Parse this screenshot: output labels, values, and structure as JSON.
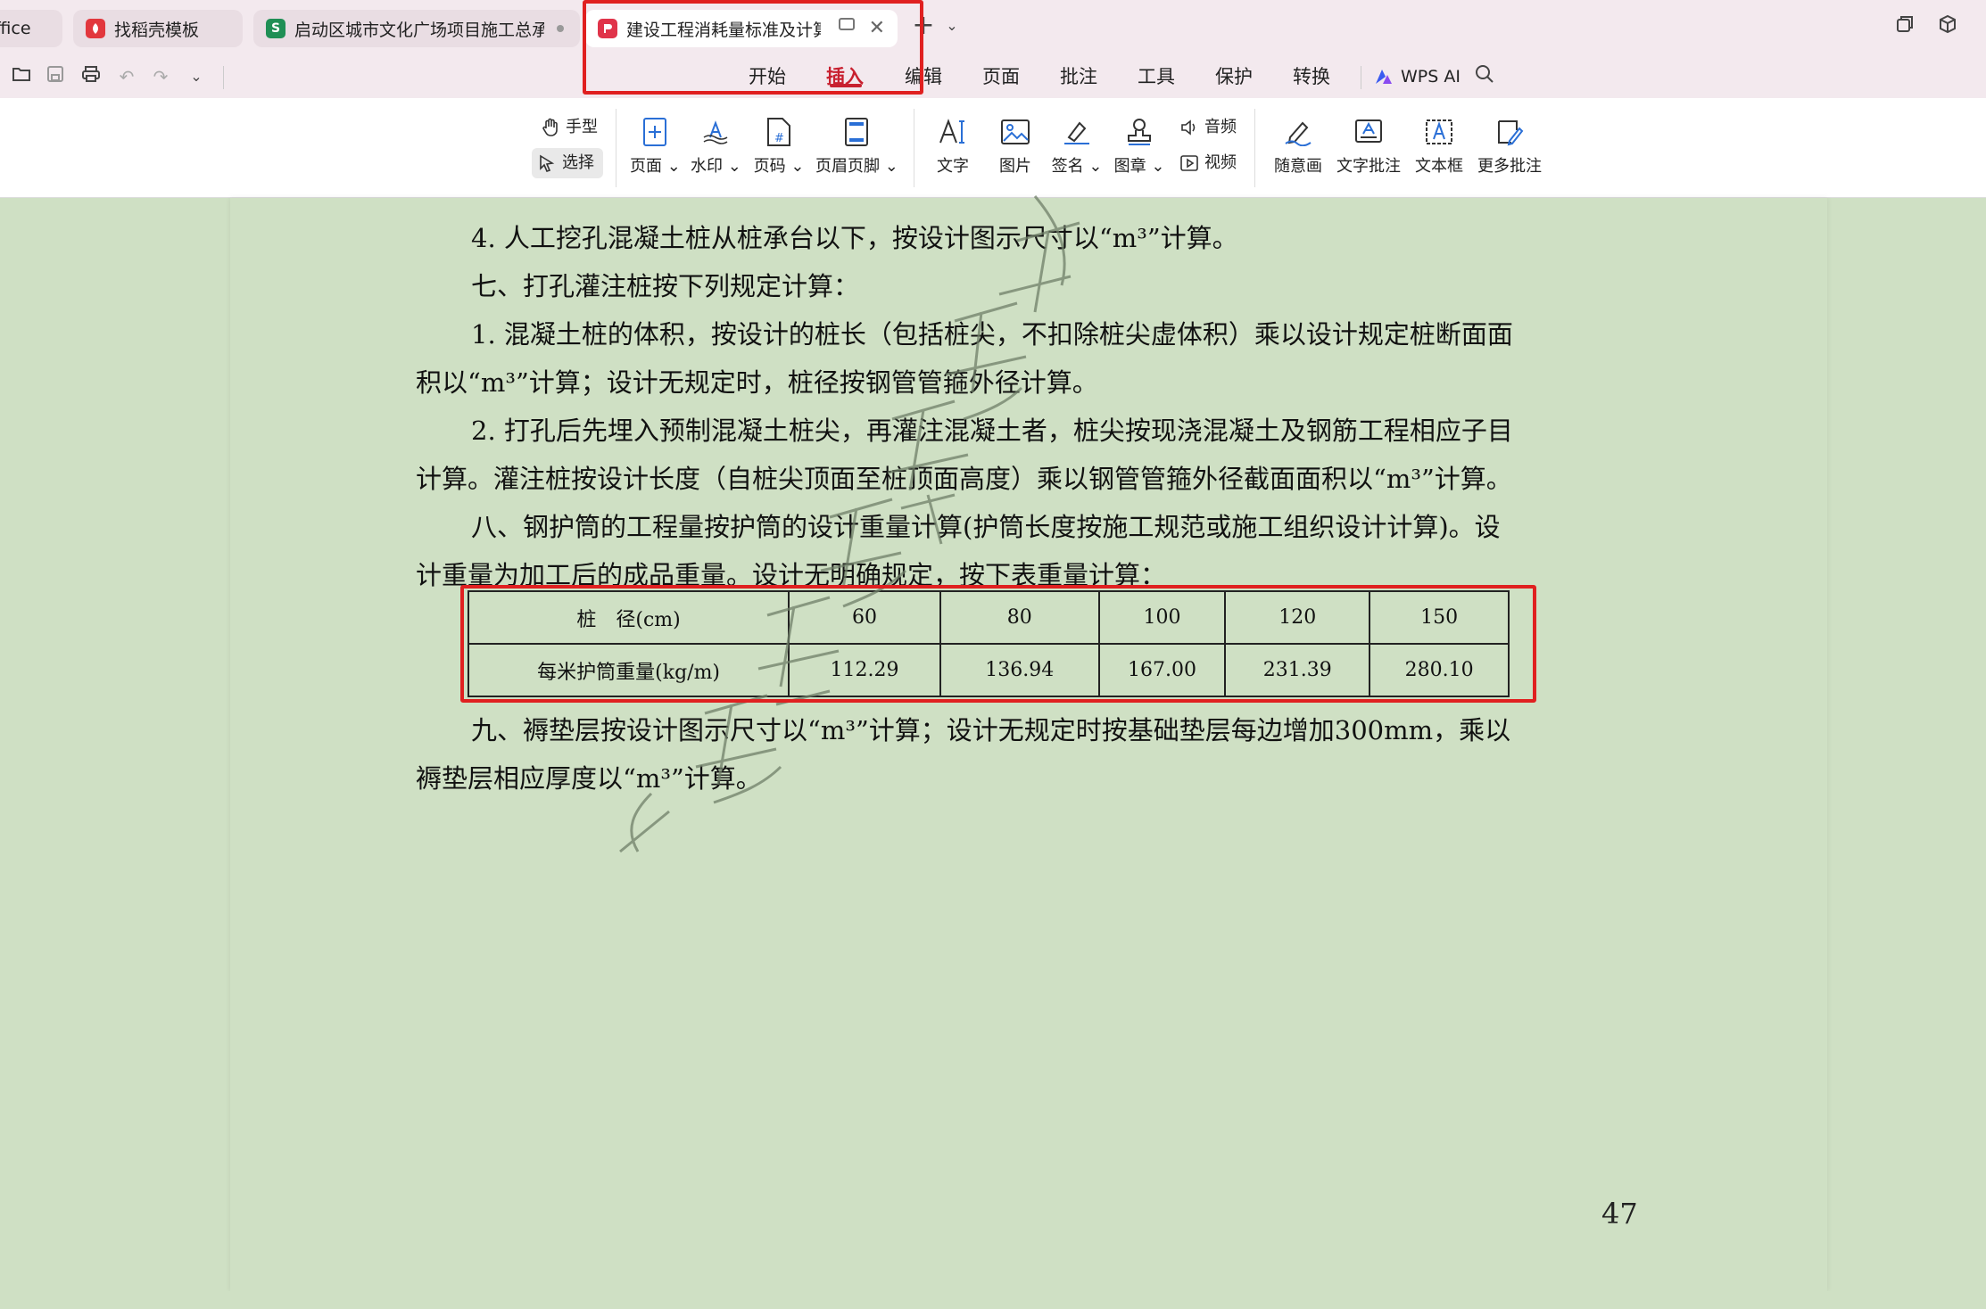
{
  "tabs": [
    {
      "label": "ffice",
      "icon": "office-icon"
    },
    {
      "label": "找稻壳模板",
      "icon": "docer-icon",
      "color": "#e2373d"
    },
    {
      "label": "启动区城市文化广场项目施工总承",
      "icon": "sheet-icon",
      "icon_text": "S",
      "color": "#1f8f55"
    },
    {
      "label": "建设工程消耗量标准及计算规",
      "icon": "pdf-icon",
      "color": "#e0344a",
      "active": true
    }
  ],
  "menu": [
    "开始",
    "插入",
    "编辑",
    "页面",
    "批注",
    "工具",
    "保护",
    "转换"
  ],
  "menu_active": "插入",
  "wps_ai": "WPS AI",
  "ribbon": {
    "hand": "手型",
    "select": "选择",
    "page": "页面",
    "watermark": "水印",
    "page_number": "页码",
    "header_footer": "页眉页脚",
    "text": "文字",
    "picture": "图片",
    "signature": "签名",
    "stamp": "图章",
    "audio": "音频",
    "video": "视频",
    "freehand": "随意画",
    "text_comment": "文字批注",
    "textbox": "文本框",
    "more_comments": "更多批注"
  },
  "document": {
    "lines": [
      "4. 人工挖孔混凝土桩从桩承台以下，按设计图示尺寸以“m³”计算。",
      "七、打孔灌注桩按下列规定计算：",
      "1. 混凝土桩的体积，按设计的桩长（包括桩尖，不扣除桩尖虚体积）乘以设计规定桩断面面",
      "积以“m³”计算；设计无规定时，桩径按钢管管箍外径计算。",
      "2. 打孔后先埋入预制混凝土桩尖，再灌注混凝土者，桩尖按现浇混凝土及钢筋工程相应子目",
      "计算。灌注桩按设计长度（自桩尖顶面至桩顶面高度）乘以钢管管箍外径截面面积以“m³”计算。",
      "八、钢护筒的工程量按护筒的设计重量计算(护筒长度按施工规范或施工组织设计计算)。设",
      "计重量为加工后的成品重量。设计无明确规定，按下表重量计算：",
      "九、褥垫层按设计图示尺寸以“m³”计算；设计无规定时按基础垫层每边增加300mm，乘以",
      "褥垫层相应厚度以“m³”计算。"
    ],
    "table": {
      "header_label": "桩　径(cm)",
      "row_label": "每米护筒重量(kg/m)",
      "diameters": [
        "60",
        "80",
        "100",
        "120",
        "150"
      ],
      "weights": [
        "112.29",
        "136.94",
        "167.00",
        "231.39",
        "280.10"
      ]
    },
    "page_number": "47"
  },
  "colors": {
    "accent": "#c8202f",
    "highlight_box": "#e02020",
    "page_bg": "#cfe0c4"
  }
}
